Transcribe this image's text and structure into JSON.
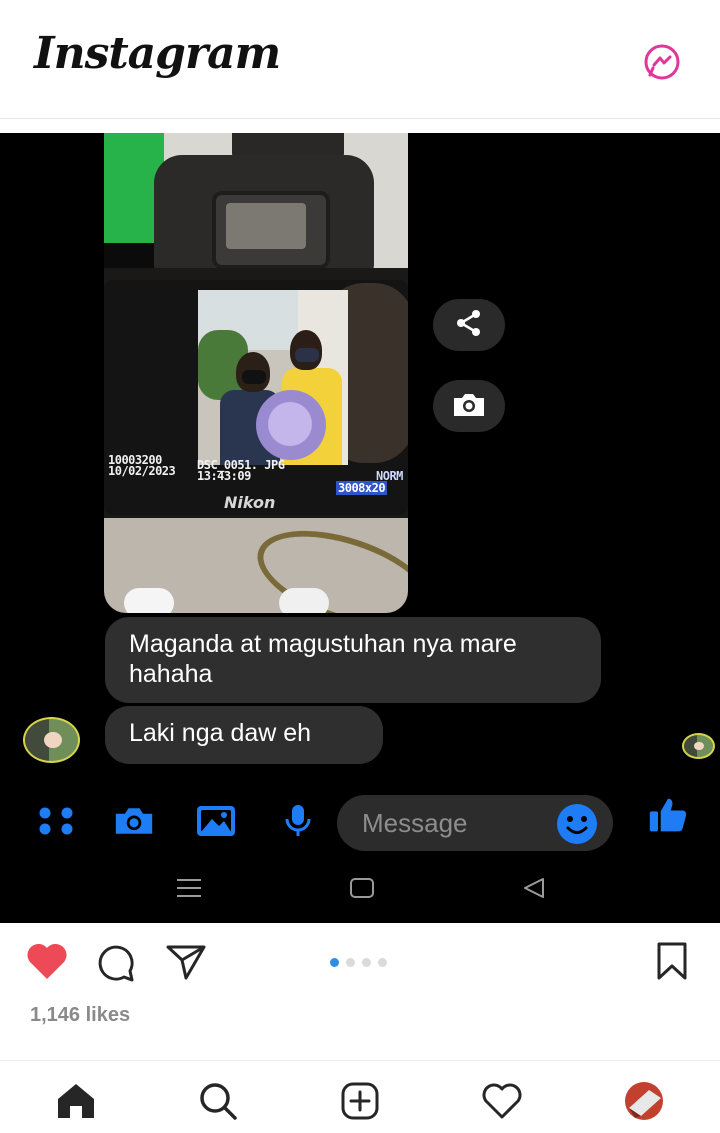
{
  "header": {
    "logo": "Instagram",
    "messenger_icon": "messenger-icon"
  },
  "chat": {
    "photo": {
      "osd_left": "10003200\n10/02/2023",
      "osd_center": "DSC_0051. JPG\n13:43:09",
      "osd_right_top": "NORM",
      "osd_right_size": "3008x20",
      "brand": "Nikon"
    },
    "share_icon": "share-icon",
    "save_icon": "camera-icon",
    "messages": [
      {
        "text": "Maganda at magustuhan nya mare hahaha"
      },
      {
        "text": "Laki nga daw eh"
      }
    ],
    "composer": {
      "placeholder": "Message",
      "icons": [
        "apps-icon",
        "camera-icon",
        "gallery-icon",
        "microphone-icon",
        "emoji-icon",
        "like-thumb-icon"
      ],
      "accent": "#1e7cf5"
    },
    "system_nav": [
      "menu-icon",
      "home-square-icon",
      "back-triangle-icon"
    ]
  },
  "post": {
    "likes": "1,146 likes",
    "carousel": {
      "count": 4,
      "active": 1
    },
    "like_color": "#ed4956"
  },
  "bottom_nav": [
    "home-icon",
    "search-icon",
    "new-post-icon",
    "activity-heart-icon",
    "profile-avatar-icon"
  ]
}
